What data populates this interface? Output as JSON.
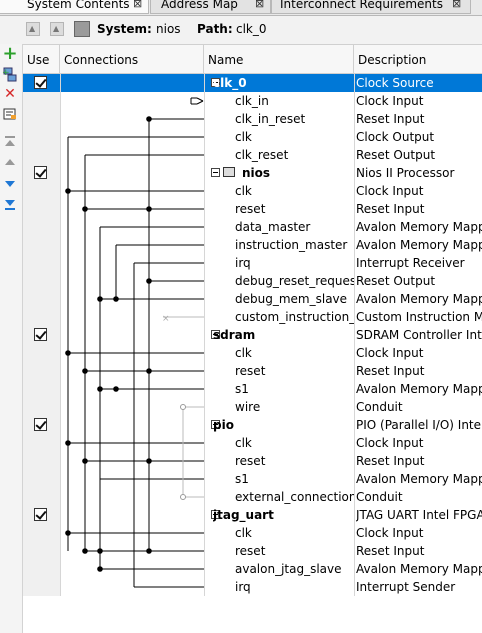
{
  "tabs": [
    {
      "label": "System Contents",
      "close": "⊠"
    },
    {
      "label": "Address Map",
      "close": "⊠"
    },
    {
      "label": "Interconnect Requirements",
      "close": "⊠"
    }
  ],
  "toolbar": {
    "system_label": "System:",
    "system_value": "nios",
    "path_label": "Path:",
    "path_value": "clk_0"
  },
  "sidebar": {
    "add": "+",
    "remove": "✕",
    "move_top": "⏫",
    "move_up": "▲",
    "move_down": "▼",
    "move_bottom": "⏬"
  },
  "columns": {
    "use": "Use",
    "connections": "Connections",
    "name": "Name",
    "description": "Description"
  },
  "rows": [
    {
      "name": "clk_0",
      "desc": "Clock Source",
      "type": "component",
      "checked": true,
      "selected": true
    },
    {
      "name": "clk_in",
      "desc": "Clock Input",
      "type": "port"
    },
    {
      "name": "clk_in_reset",
      "desc": "Reset Input",
      "type": "port"
    },
    {
      "name": "clk",
      "desc": "Clock Output",
      "type": "port"
    },
    {
      "name": "clk_reset",
      "desc": "Reset Output",
      "type": "port"
    },
    {
      "name": "nios",
      "desc": "Nios II Processor",
      "type": "component",
      "checked": true,
      "cpu": true
    },
    {
      "name": "clk",
      "desc": "Clock Input",
      "type": "port"
    },
    {
      "name": "reset",
      "desc": "Reset Input",
      "type": "port"
    },
    {
      "name": "data_master",
      "desc": "Avalon Memory Mapped Master",
      "type": "port"
    },
    {
      "name": "instruction_master",
      "desc": "Avalon Memory Mapped Master",
      "type": "port"
    },
    {
      "name": "irq",
      "desc": "Interrupt Receiver",
      "type": "port"
    },
    {
      "name": "debug_reset_request",
      "desc": "Reset Output",
      "type": "port"
    },
    {
      "name": "debug_mem_slave",
      "desc": "Avalon Memory Mapped Slave",
      "type": "port"
    },
    {
      "name": "custom_instruction_master",
      "desc": "Custom Instruction Master",
      "type": "port"
    },
    {
      "name": "sdram",
      "desc": "SDRAM Controller Intel FPGA IP",
      "type": "component",
      "checked": true
    },
    {
      "name": "clk",
      "desc": "Clock Input",
      "type": "port"
    },
    {
      "name": "reset",
      "desc": "Reset Input",
      "type": "port"
    },
    {
      "name": "s1",
      "desc": "Avalon Memory Mapped Slave",
      "type": "port"
    },
    {
      "name": "wire",
      "desc": "Conduit",
      "type": "port"
    },
    {
      "name": "pio",
      "desc": "PIO (Parallel I/O) Intel FPGA IP",
      "type": "component",
      "checked": true
    },
    {
      "name": "clk",
      "desc": "Clock Input",
      "type": "port"
    },
    {
      "name": "reset",
      "desc": "Reset Input",
      "type": "port"
    },
    {
      "name": "s1",
      "desc": "Avalon Memory Mapped Slave",
      "type": "port"
    },
    {
      "name": "external_connection",
      "desc": "Conduit",
      "type": "port"
    },
    {
      "name": "jtag_uart",
      "desc": "JTAG UART Intel FPGA IP",
      "type": "component",
      "checked": true
    },
    {
      "name": "clk",
      "desc": "Clock Input",
      "type": "port"
    },
    {
      "name": "reset",
      "desc": "Reset Input",
      "type": "port"
    },
    {
      "name": "avalon_jtag_slave",
      "desc": "Avalon Memory Mapped Slave",
      "type": "port"
    },
    {
      "name": "irq",
      "desc": "Interrupt Sender",
      "type": "port"
    }
  ],
  "colors": {
    "selection": "#0078d7",
    "add_green": "#2ca02c",
    "remove_red": "#d62728",
    "arrow_blue": "#1f77d4"
  }
}
